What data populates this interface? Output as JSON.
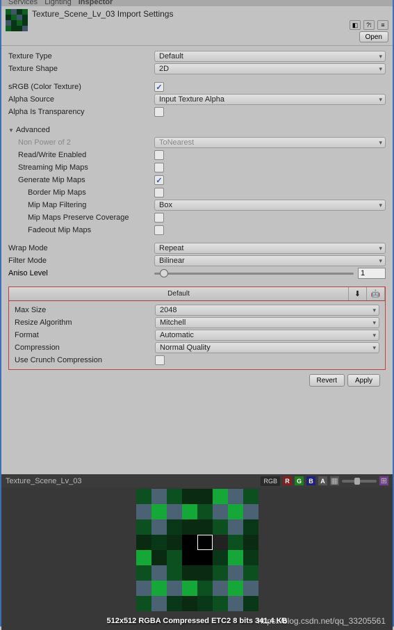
{
  "tabs": {
    "services": "Services",
    "lighting": "Lighting",
    "inspector": "Inspector"
  },
  "header": {
    "title": "Texture_Scene_Lv_03 Import Settings",
    "open": "Open"
  },
  "fields": {
    "texture_type": {
      "label": "Texture Type",
      "value": "Default"
    },
    "texture_shape": {
      "label": "Texture Shape",
      "value": "2D"
    },
    "srgb": {
      "label": "sRGB (Color Texture)",
      "checked": true
    },
    "alpha_source": {
      "label": "Alpha Source",
      "value": "Input Texture Alpha"
    },
    "alpha_trans": {
      "label": "Alpha Is Transparency",
      "checked": false
    }
  },
  "advanced": {
    "title": "Advanced",
    "npot": {
      "label": "Non Power of 2",
      "value": "ToNearest"
    },
    "rw": {
      "label": "Read/Write Enabled",
      "checked": false
    },
    "stream": {
      "label": "Streaming Mip Maps",
      "checked": false
    },
    "genmip": {
      "label": "Generate Mip Maps",
      "checked": true
    },
    "border": {
      "label": "Border Mip Maps",
      "checked": false
    },
    "filter": {
      "label": "Mip Map Filtering",
      "value": "Box"
    },
    "coverage": {
      "label": "Mip Maps Preserve Coverage",
      "checked": false
    },
    "fadeout": {
      "label": "Fadeout Mip Maps",
      "checked": false
    }
  },
  "wrap": {
    "label": "Wrap Mode",
    "value": "Repeat"
  },
  "filtermode": {
    "label": "Filter Mode",
    "value": "Bilinear"
  },
  "aniso": {
    "label": "Aniso Level",
    "value": "1"
  },
  "platform": {
    "tab": "Default",
    "maxsize": {
      "label": "Max Size",
      "value": "2048"
    },
    "resize": {
      "label": "Resize Algorithm",
      "value": "Mitchell"
    },
    "format": {
      "label": "Format",
      "value": "Automatic"
    },
    "compression": {
      "label": "Compression",
      "value": "Normal Quality"
    },
    "crunch": {
      "label": "Use Crunch Compression",
      "checked": false
    }
  },
  "buttons": {
    "revert": "Revert",
    "apply": "Apply"
  },
  "preview": {
    "name": "Texture_Scene_Lv_03",
    "rgb": "RGB",
    "info": "512x512  RGBA Compressed ETC2 8 bits   341.4 KB"
  },
  "watermark": "https://blog.csdn.net/qq_33205561"
}
